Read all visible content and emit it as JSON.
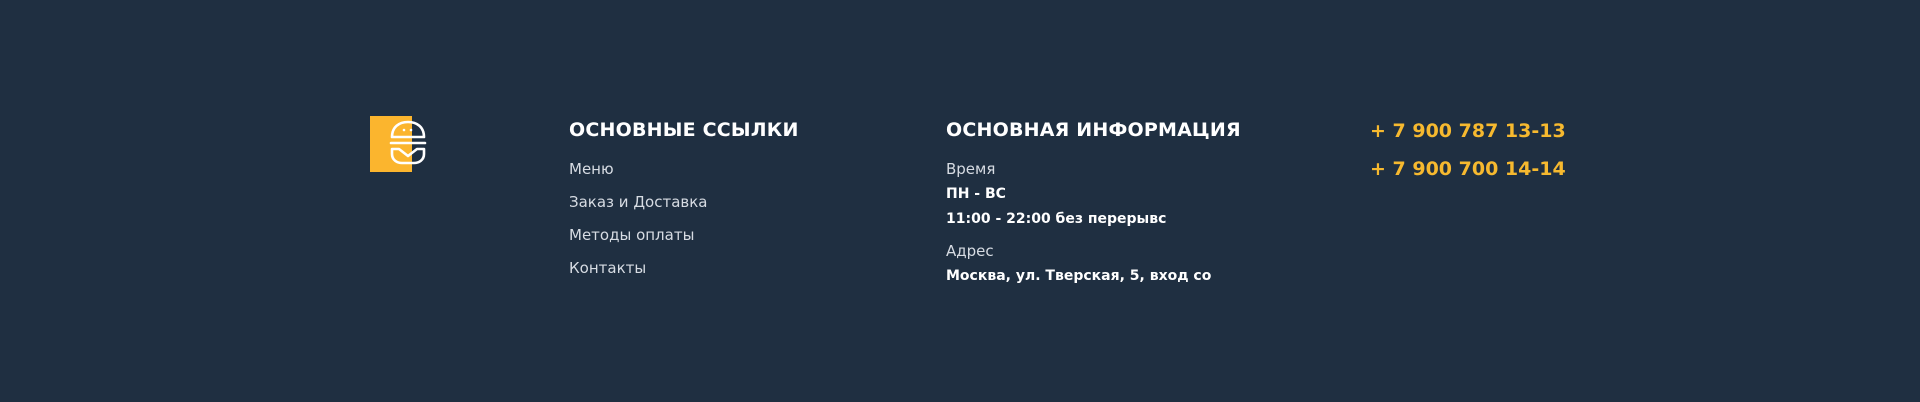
{
  "brand": {
    "logo_icon": "burger-icon",
    "accent_color": "#fbb52e",
    "background_color": "#1f2f41"
  },
  "links": {
    "title": "ОСНОВНЫЕ ССЫЛКИ",
    "items": [
      {
        "label": "Меню"
      },
      {
        "label": "Заказ и Доставка"
      },
      {
        "label": "Методы оплаты"
      },
      {
        "label": "Контакты"
      }
    ]
  },
  "info": {
    "title": "ОСНОВНАЯ ИНФОРМАЦИЯ",
    "time_label": "Время",
    "days": "ПН - ВС",
    "hours": "11:00 - 22:00 без перерывс",
    "address_label": "Адрес",
    "address": "Москва, ул. Тверская, 5, вход со"
  },
  "contacts": {
    "phones": [
      "+ 7 900 787 13-13",
      "+ 7 900 700 14-14"
    ],
    "phone_color": "#f6b92f"
  }
}
